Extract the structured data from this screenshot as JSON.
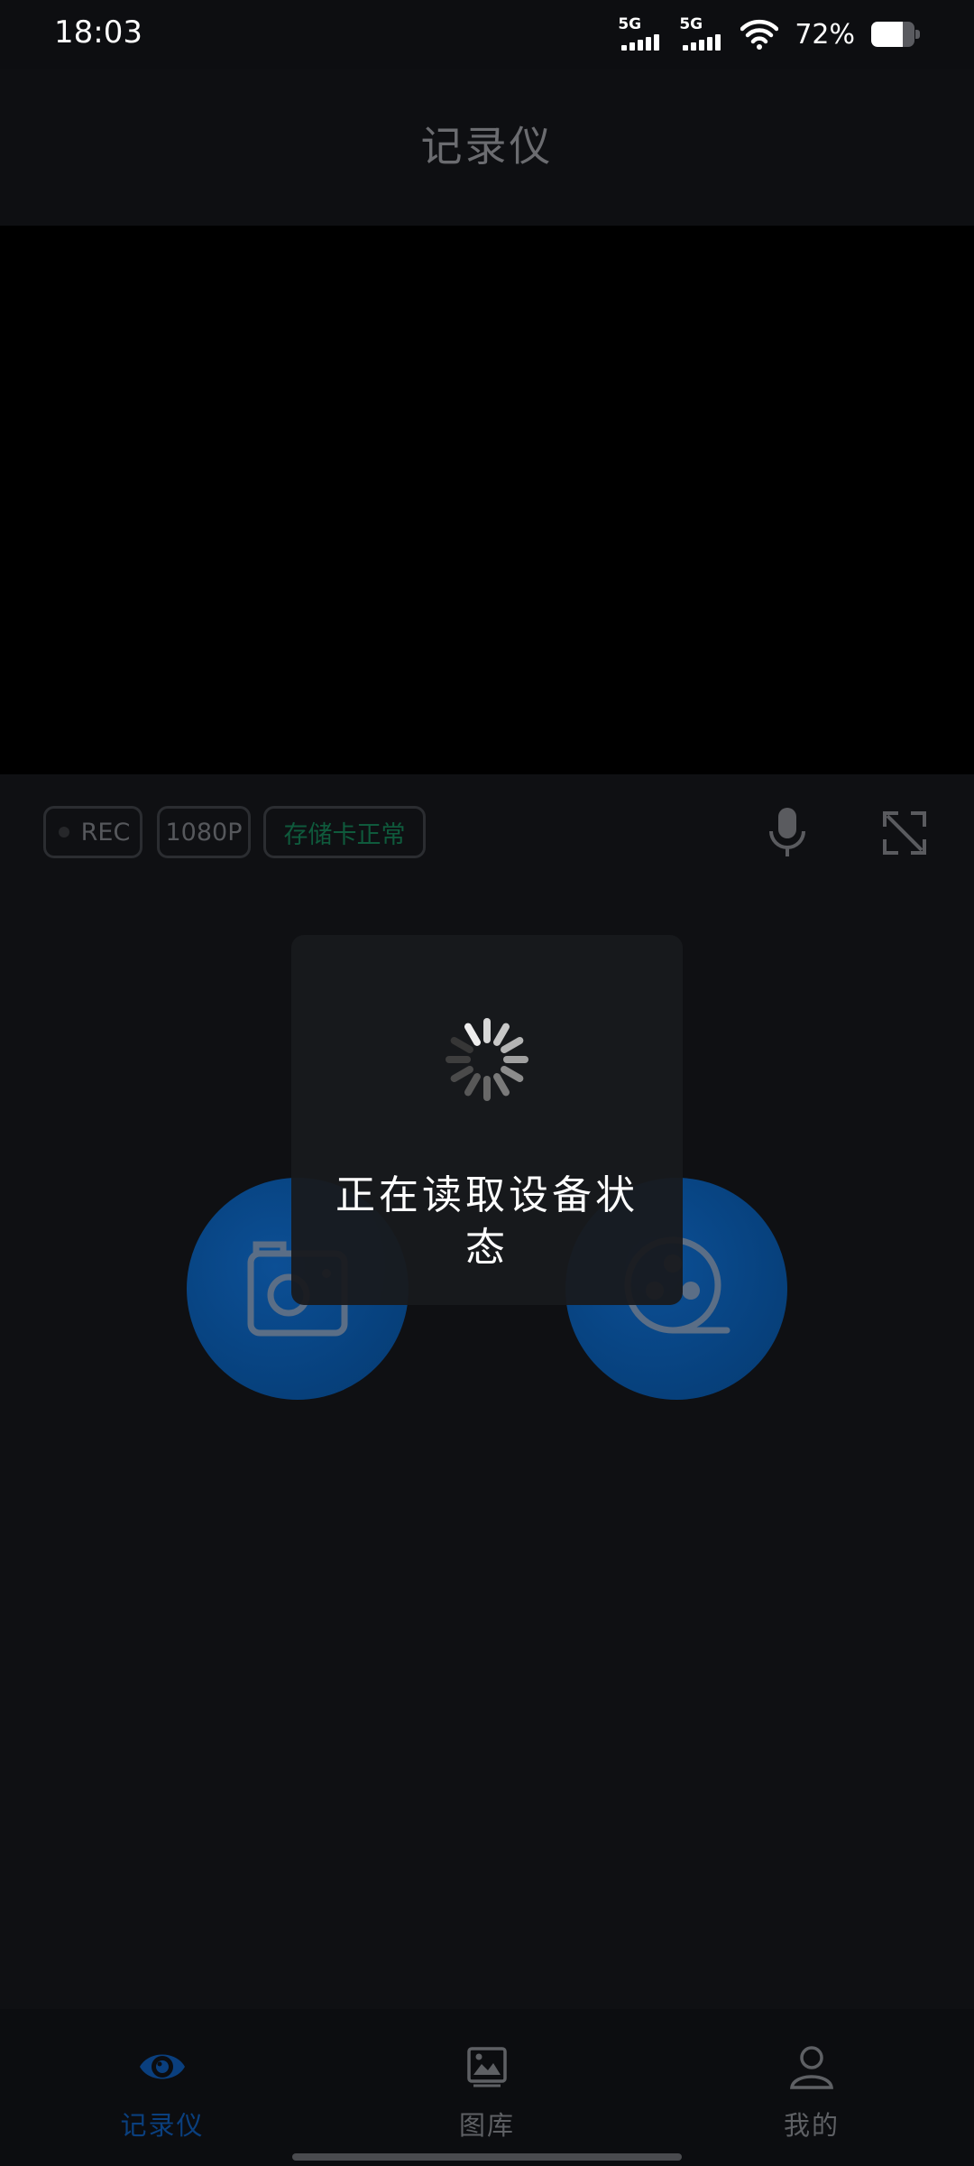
{
  "status_bar": {
    "time": "18:03",
    "network1": "5G",
    "network2": "5G",
    "battery_percent": "72%",
    "battery_level": 0.72
  },
  "header": {
    "title": "记录仪"
  },
  "chips": {
    "rec": "REC",
    "resolution": "1080P",
    "storage": "存储卡正常"
  },
  "loading": {
    "message": "正在读取设备状态"
  },
  "icons": {
    "mic": "microphone-icon",
    "fullscreen": "expand-icon",
    "photo": "camera-icon",
    "video": "film-reel-icon",
    "nav_recorder": "eye-icon",
    "nav_gallery": "image-icon",
    "nav_mine": "person-icon"
  },
  "colors": {
    "accent": "#0a3f7e",
    "storage_ok": "#0f5a3c",
    "button_blue": "#07427f"
  },
  "bottom_nav": {
    "items": [
      {
        "label": "记录仪",
        "active": true
      },
      {
        "label": "图库",
        "active": false
      },
      {
        "label": "我的",
        "active": false
      }
    ]
  }
}
